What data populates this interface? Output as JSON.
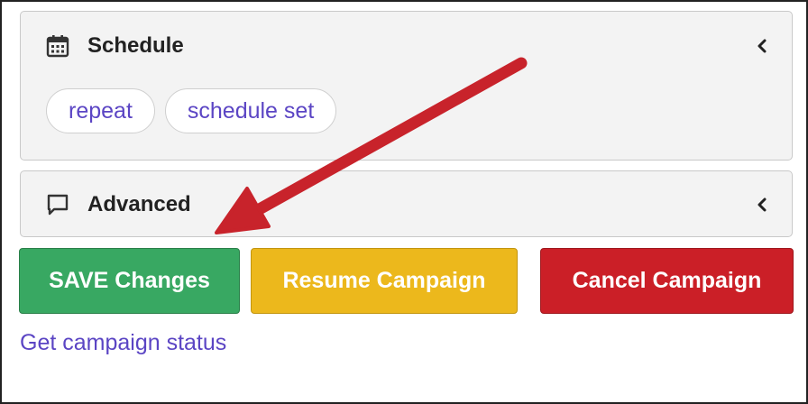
{
  "schedule": {
    "title": "Schedule",
    "icon": "calendar-icon",
    "chips": [
      "repeat",
      "schedule set"
    ]
  },
  "advanced": {
    "title": "Advanced",
    "icon": "comment-icon"
  },
  "buttons": {
    "save": "SAVE Changes",
    "resume": "Resume Campaign",
    "cancel": "Cancel Campaign"
  },
  "link": "Get campaign status",
  "colors": {
    "save": "#38a862",
    "resume": "#ecb81c",
    "cancel": "#cb1f27",
    "link": "#5b45c4",
    "annotation_arrow": "#c8232b"
  }
}
